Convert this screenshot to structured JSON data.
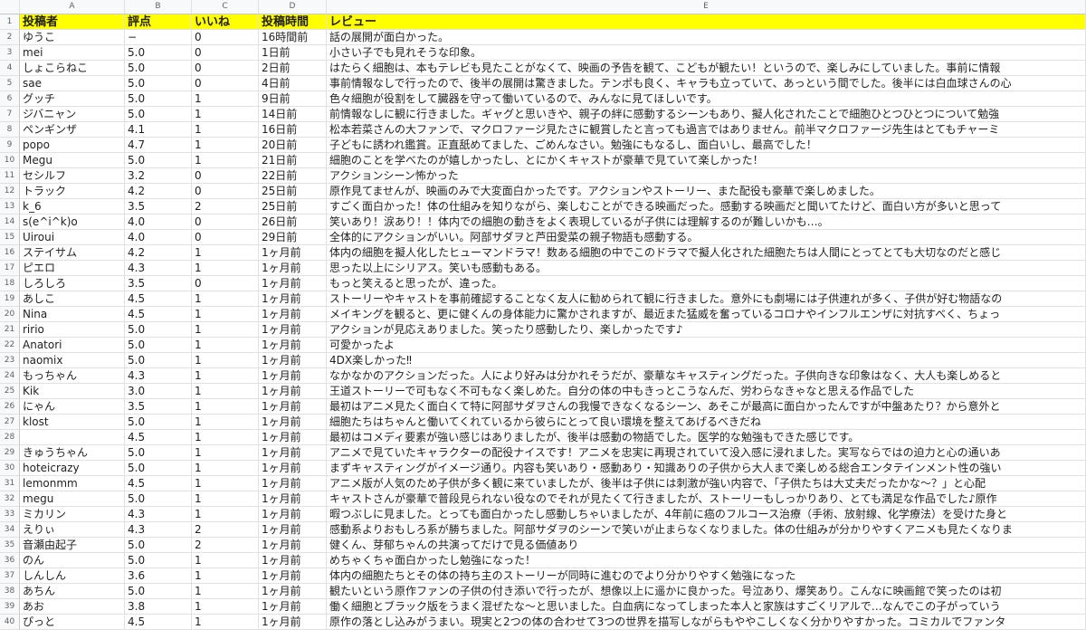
{
  "columns": [
    "A",
    "B",
    "C",
    "D",
    "E"
  ],
  "header": [
    "投稿者",
    "評点",
    "いいね",
    "投稿時間",
    "レビュー"
  ],
  "rows": [
    [
      "ゆうこ",
      "−",
      "0",
      "16時間前",
      "話の展開が面白かった。"
    ],
    [
      "mei",
      "5.0",
      "0",
      "1日前",
      "小さい子でも見れそうな印象。"
    ],
    [
      "しょこらねこ",
      "5.0",
      "0",
      "2日前",
      "はたらく細胞は、本もテレビも見たことがなくて、映画の予告を観て、こどもが観たい！というので、楽しみにしていました。事前に情報"
    ],
    [
      "sae",
      "5.0",
      "0",
      "4日前",
      "事前情報なしで行ったので、後半の展開は驚きました。テンポも良く、キャラも立っていて、あっという間でした。後半には白血球さんの心"
    ],
    [
      "グッチ",
      "5.0",
      "1",
      "9日前",
      "色々細胞が役割をして臓器を守って働いているので、みんなに見てほしいです。"
    ],
    [
      "ジバニャン",
      "5.0",
      "1",
      "14日前",
      "前情報なしに観に行きました。ギャグと思いきや、親子の絆に感動するシーンもあり、擬人化されたことで細胞ひとつひとつについて勉強"
    ],
    [
      "ペンギンザ",
      "4.1",
      "1",
      "16日前",
      "松本若菜さんの大ファンで、マクロファージ見たさに観賞したと言っても過言ではありません。前半マクロファージ先生はとてもチャーミ"
    ],
    [
      "popo",
      "4.7",
      "1",
      "20日前",
      "子どもに誘われ鑑賞。正直舐めてました、ごめんなさい。勉強にもなるし、面白いし、最高でした！"
    ],
    [
      "Megu",
      "5.0",
      "1",
      "21日前",
      "細胞のことを学べたのが嬉しかったし、とにかくキャストが豪華で見ていて楽しかった！"
    ],
    [
      "セシルフ",
      "3.2",
      "0",
      "22日前",
      "アクションシーン怖かった"
    ],
    [
      "トラック",
      "4.2",
      "0",
      "25日前",
      "原作見てませんが、映画のみで大変面白かったです。アクションやストーリー、また配役も豪華で楽しめました。"
    ],
    [
      "k_6",
      "3.5",
      "2",
      "25日前",
      "すごく面白かった！体の仕組みを知りながら、楽しむことができる映画だった。感動する映画だと聞いてたけど、面白い方が多いと思って"
    ],
    [
      "s(e^i^k)o",
      "4.0",
      "0",
      "26日前",
      "笑いあり！涙あり！！体内での細胞の動きをよく表現しているが子供には理解するのが難しいかも…。"
    ],
    [
      "Uiroui",
      "4.0",
      "0",
      "29日前",
      "全体的にアクションがいい。阿部サダヲと芦田愛菜の親子物語も感動する。"
    ],
    [
      "ステイサム",
      "4.2",
      "1",
      "1ヶ月前",
      "体内の細胞を擬人化したヒューマンドラマ！数ある細胞の中でこのドラマで擬人化された細胞たちは人間にとってとても大切なのだと感じ"
    ],
    [
      "ピエロ",
      "4.3",
      "1",
      "1ヶ月前",
      "思った以上にシリアス。笑いも感動もある。"
    ],
    [
      "しろしろ",
      "3.5",
      "0",
      "1ヶ月前",
      "もっと笑えると思ったが、違った。"
    ],
    [
      "あしこ",
      "4.5",
      "1",
      "1ヶ月前",
      "ストーリーやキャストを事前確認することなく友人に勧められて観に行きました。意外にも劇場には子供連れが多く、子供が好む物語なの"
    ],
    [
      "Nina",
      "4.5",
      "1",
      "1ヶ月前",
      "メイキングを観ると、更に健くんの身体能力に驚かされますが、最近また猛威を奮っているコロナやインフルエンザに対抗すべく、ちょっ"
    ],
    [
      "ririo",
      "5.0",
      "1",
      "1ヶ月前",
      "アクションが見応えありました。笑ったり感動したり、楽しかったです♪"
    ],
    [
      "Anatori",
      "5.0",
      "1",
      "1ヶ月前",
      "可愛かったよ"
    ],
    [
      "naomix",
      "5.0",
      "1",
      "1ヶ月前",
      "4DX楽しかった‼︎"
    ],
    [
      "もっちゃん",
      "4.3",
      "1",
      "1ヶ月前",
      "なかなかのアクションだった。人により好みは分かれそうだが、豪華なキャスティングだった。子供向きな印象はなく、大人も楽しめると"
    ],
    [
      "Kik",
      "3.0",
      "1",
      "1ヶ月前",
      "王道ストーリーで可もなく不可もなく楽しめた。自分の体の中もきっとこうなんだ、労わらなきゃなと思える作品でした"
    ],
    [
      "にゃん",
      "3.5",
      "1",
      "1ヶ月前",
      "最初はアニメ見たく面白くて特に阿部サダヲさんの我慢できなくなるシーン、あそこが最高に面白かったんですが中盤あたり？から意外と"
    ],
    [
      "klost",
      "5.0",
      "1",
      "1ヶ月前",
      "細胞たちはちゃんと働いてくれているから彼らにとって良い環境を整えてあげるべきだね"
    ],
    [
      "",
      "4.5",
      "1",
      "1ヶ月前",
      "最初はコメディ要素が強い感じはありましたが、後半は感動の物語でした。医学的な勉強もできた感じです。"
    ],
    [
      "きゅうちゃん",
      "5.0",
      "1",
      "1ヶ月前",
      "アニメで見ていたキャラクターの配役ナイスです！アニメを忠実に再現されていて没入感に浸れました。実写ならではの迫力と心の通いあ"
    ],
    [
      "hoteicrazy",
      "5.0",
      "1",
      "1ヶ月前",
      "まずキャスティングがイメージ通り。内容も笑いあり・感動あり・知識ありの子供から大人まで楽しめる総合エンタテインメント性の強い"
    ],
    [
      "lemonmm",
      "4.5",
      "1",
      "1ヶ月前",
      "アニメ版が人気のため子供が多く観に来ていましたが、後半は子供には刺激が強い内容で、「子供たちは大丈夫だったかな〜？」と心配"
    ],
    [
      "megu",
      "5.0",
      "1",
      "1ヶ月前",
      "キャストさんが豪華で普段見られない役なのでそれが見たくて行きましたが、ストーリーもしっかりあり、とても満足な作品でした♪原作"
    ],
    [
      "ミカリン",
      "4.3",
      "1",
      "1ヶ月前",
      "暇つぶしに見ました。とっても面白かったし感動しちゃいましたが、4年前に癌のフルコース治療（手術、放射線、化学療法）を受けた身と"
    ],
    [
      "えりぃ",
      "4.3",
      "2",
      "1ヶ月前",
      "感動系よりおもしろ系が勝ちました。阿部サダヲのシーンで笑いが止まらなくなりました。体の仕組みが分かりやすくアニメも見たくなりま"
    ],
    [
      "音瀬由起子",
      "5.0",
      "2",
      "1ヶ月前",
      "健くん、芽郁ちゃんの共演ってだけで見る価値あり"
    ],
    [
      "のん",
      "5.0",
      "1",
      "1ヶ月前",
      "めちゃくちゃ面白かったし勉強になった！"
    ],
    [
      "しんしん",
      "3.6",
      "1",
      "1ヶ月前",
      "体内の細胞たちとその体の持ち主のストーリーが同時に進むのでより分かりやすく勉強になった"
    ],
    [
      "あちん",
      "5.0",
      "1",
      "1ヶ月前",
      "観たいという原作ファンの子供の付き添いで行ったが、想像以上に遥かに良かった。号泣あり、爆笑あり。こんなに映画館で笑ったのは初"
    ],
    [
      "あお",
      "3.8",
      "1",
      "1ヶ月前",
      "働く細胞とブラック版をうまく混ぜたな〜と思いました。白血病になってしまった本人と家族はすごくリアルで…なんでこの子がっていう"
    ],
    [
      "ぴっと",
      "4.5",
      "1",
      "1ヶ月前",
      "原作の落とし込みがうまい。現実と2つの体の合わせて3つの世界を描写しながらもややこしくなく分かりやすかった。コミカルでファンタ"
    ]
  ]
}
